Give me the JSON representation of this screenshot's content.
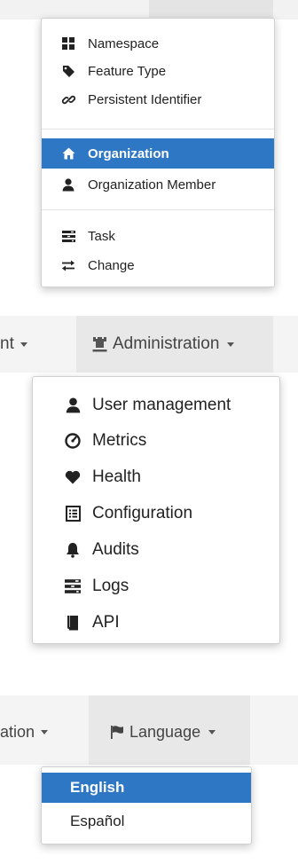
{
  "entities_menu": {
    "items": [
      {
        "label": "Namespace",
        "icon": "th-large-icon"
      },
      {
        "label": "Feature Type",
        "icon": "tag-icon"
      },
      {
        "label": "Persistent Identifier",
        "icon": "link-icon"
      },
      {
        "label": "Organization",
        "icon": "home-icon",
        "active": true
      },
      {
        "label": "Organization Member",
        "icon": "user-icon"
      },
      {
        "label": "Task",
        "icon": "tasks-icon"
      },
      {
        "label": "Change",
        "icon": "transfer-icon"
      }
    ]
  },
  "admin_nav": {
    "prev_label": "nt",
    "label": "Administration",
    "icon": "tower-icon"
  },
  "admin_menu": {
    "items": [
      {
        "label": "User management",
        "icon": "user-icon"
      },
      {
        "label": "Metrics",
        "icon": "dashboard-icon"
      },
      {
        "label": "Health",
        "icon": "heart-icon"
      },
      {
        "label": "Configuration",
        "icon": "list-alt-icon"
      },
      {
        "label": "Audits",
        "icon": "bell-icon"
      },
      {
        "label": "Logs",
        "icon": "tasks-icon"
      },
      {
        "label": "API",
        "icon": "book-icon"
      }
    ]
  },
  "language_nav": {
    "prev_label": "ation",
    "label": "Language",
    "icon": "flag-icon"
  },
  "language_menu": {
    "items": [
      {
        "label": "English",
        "active": true
      },
      {
        "label": "Español"
      }
    ]
  },
  "colors": {
    "active_bg": "#2e77c4",
    "nav_strip": "#f2f2f2"
  }
}
